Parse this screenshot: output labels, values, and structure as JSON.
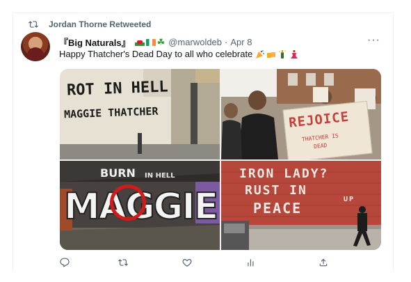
{
  "retweet": {
    "label": "Jordan Thorne Retweeted"
  },
  "tweet": {
    "display_name": "『Big Naturals』",
    "handle": "@marwoldeb",
    "separator": "·",
    "date": "Apr 8",
    "text": "Happy Thatcher's Dead Day to all who celebrate",
    "more_label": "···",
    "emoji_icons": [
      "party-popper-icon",
      "beer-mugs-icon",
      "champagne-icon",
      "dancer-icon"
    ],
    "flag_icons": [
      "wales-flag-icon",
      "ireland-flag-icon",
      "shamrock-icon"
    ]
  },
  "media": {
    "panel1": {
      "line1": "ROT IN HELL",
      "line2": "MAGGIE THATCHER"
    },
    "panel2": {
      "sign_title": "REJOICE",
      "sign_line1": "THATCHER IS",
      "sign_line2": "DEAD"
    },
    "panel3": {
      "line1": "BURN",
      "line2": "IN HELL",
      "line3": "MAGGIE"
    },
    "panel4": {
      "line1": "IRON LADY?",
      "line2": "RUST IN",
      "line3": "PEACE",
      "corner": "UP"
    }
  },
  "actions": [
    {
      "name": "reply",
      "icon": "reply-icon"
    },
    {
      "name": "retweet",
      "icon": "retweet-icon"
    },
    {
      "name": "like",
      "icon": "heart-icon"
    },
    {
      "name": "views",
      "icon": "views-icon"
    },
    {
      "name": "share",
      "icon": "share-icon"
    }
  ],
  "colors": {
    "muted": "#536471",
    "text": "#0f1419",
    "border": "#eff3f4",
    "brick": "#b94b3e"
  }
}
